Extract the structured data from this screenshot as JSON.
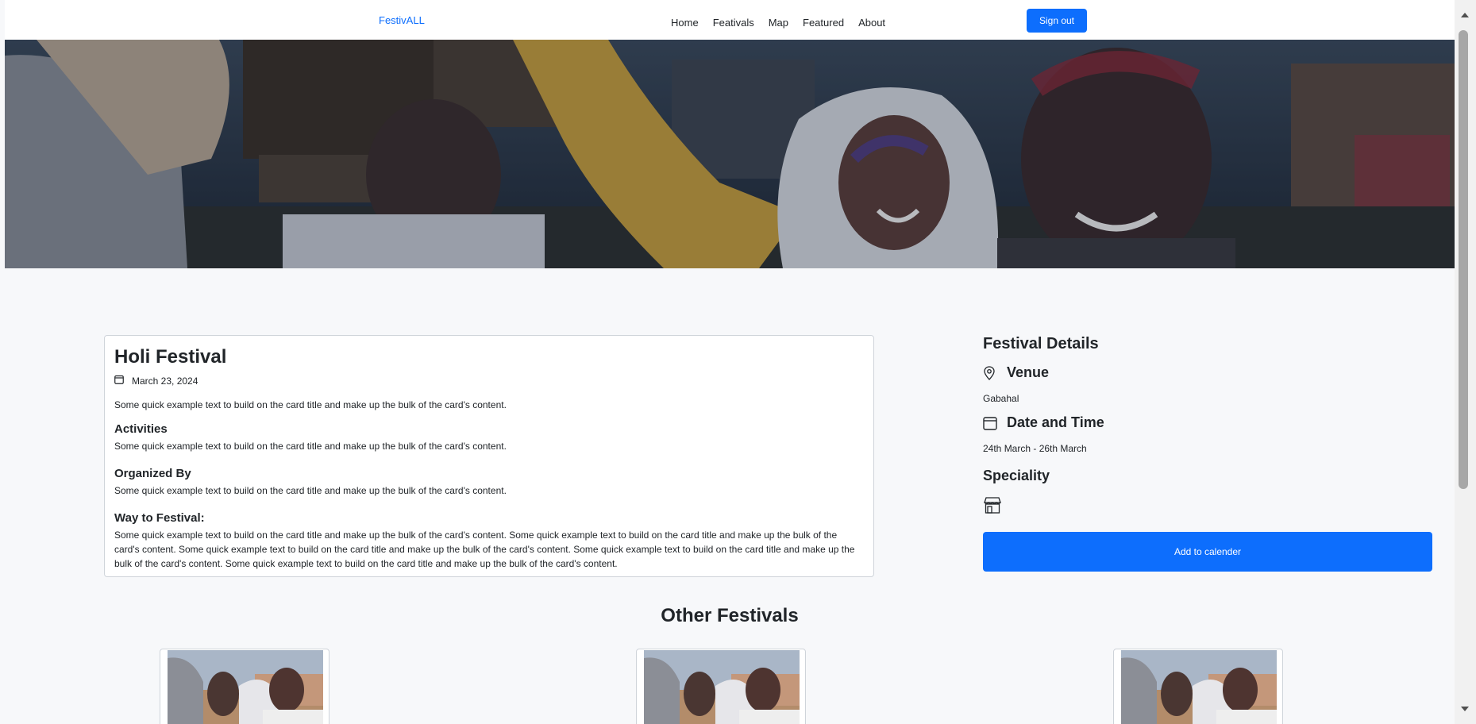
{
  "navbar": {
    "brand": "FestivALL",
    "links": [
      "Home",
      "Feativals",
      "Map",
      "Featured",
      "About"
    ],
    "signout": "Sign out"
  },
  "festival": {
    "title": "Holi Festival",
    "date": "March 23, 2024",
    "intro": "Some quick example text to build on the card title and make up the bulk of the card's content.",
    "activities_heading": "Activities",
    "activities_text": "Some quick example text to build on the card title and make up the bulk of the card's content.",
    "organized_heading": "Organized By",
    "organized_text": "Some quick example text to build on the card title and make up the bulk of the card's content.",
    "way_heading": "Way to Festival:",
    "way_text": "Some quick example text to build on the card title and make up the bulk of the card's content. Some quick example text to build on the card title and make up the bulk of the card's content. Some quick example text to build on the card title and make up the bulk of the card's content. Some quick example text to build on the card title and make up the bulk of the card's content. Some quick example text to build on the card title and make up the bulk of the card's content."
  },
  "details": {
    "heading": "Festival Details",
    "venue_label": "Venue",
    "venue_value": "Gabahal",
    "datetime_label": "Date and Time",
    "datetime_value": "24th March - 26th March",
    "speciality_label": "Speciality",
    "speciality_icon": "shop-icon",
    "add_button": "Add to calender"
  },
  "other": {
    "title": "Other Festivals"
  },
  "colors": {
    "primary": "#0d6efd",
    "background": "#f7f8fa"
  }
}
